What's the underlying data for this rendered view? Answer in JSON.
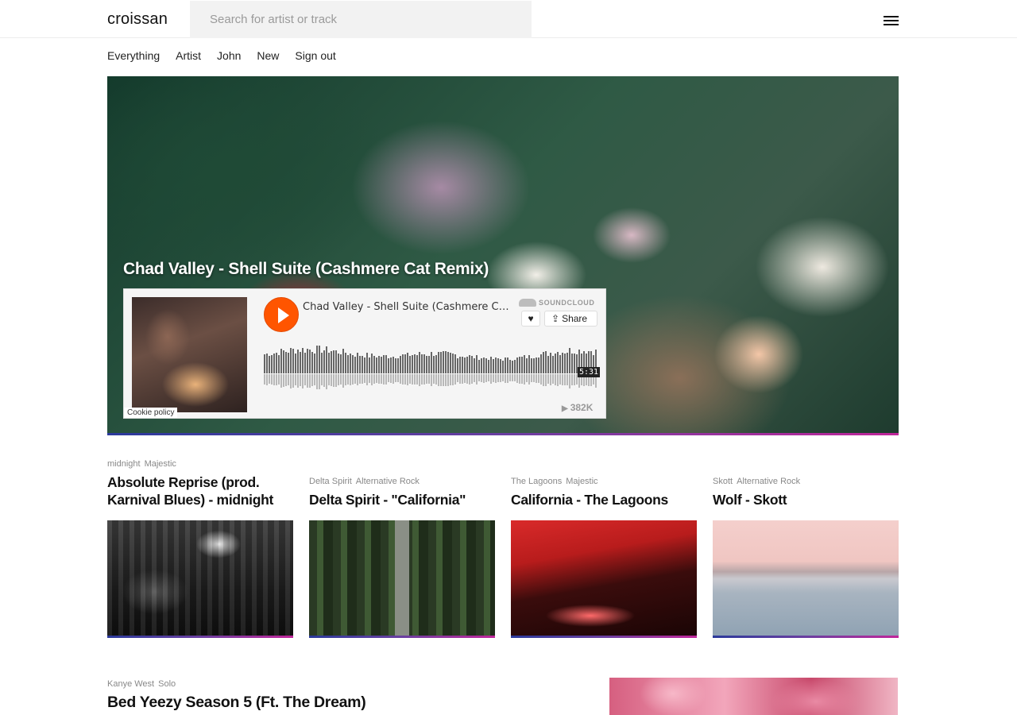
{
  "header": {
    "logo": "croissan",
    "search_placeholder": "Search for artist or track"
  },
  "nav": [
    "Everything",
    "Artist",
    "John",
    "New",
    "Sign out"
  ],
  "hero": {
    "title": "Chad Valley - Shell Suite (Cashmere Cat Remix)",
    "widget": {
      "track_title": "Chad Valley - Shell Suite (Cashmere Cat Remix)",
      "brand": "SOUNDCLOUD",
      "like_glyph": "♥",
      "share_label": "Share",
      "duration": "5:31",
      "plays": "382K",
      "cookie_label": "Cookie policy",
      "play_glyph": "▶",
      "share_glyph": "⇪"
    }
  },
  "cards": [
    {
      "tags": [
        "midnight",
        "Majestic"
      ],
      "title": "Absolute Reprise (prod. Karnival Blues) - midnight"
    },
    {
      "tags": [
        "Delta Spirit",
        "Alternative Rock"
      ],
      "title": "Delta Spirit - \"California\""
    },
    {
      "tags": [
        "The Lagoons",
        "Majestic"
      ],
      "title": "California - The Lagoons"
    },
    {
      "tags": [
        "Skott",
        "Alternative Rock"
      ],
      "title": "Wolf - Skott"
    }
  ],
  "feature": {
    "tags": [
      "Kanye West",
      "Solo"
    ],
    "title": "Bed Yeezy Season 5 (Ft. The Dream)"
  },
  "colors": {
    "accent": "#ff5500",
    "bar_start": "#2b3a9b",
    "bar_end": "#c0269a"
  }
}
